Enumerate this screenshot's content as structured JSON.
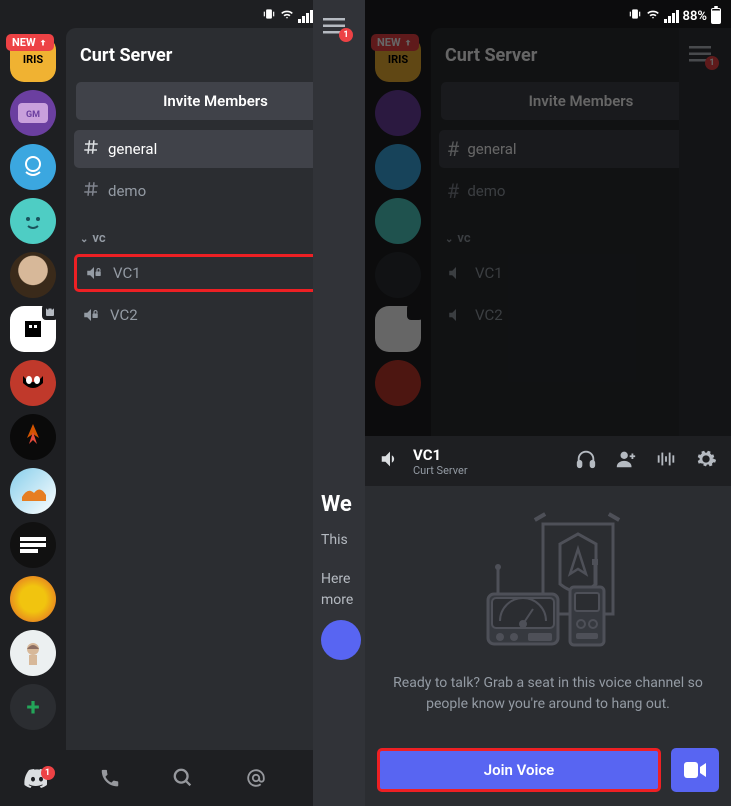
{
  "status": {
    "battery": "88%"
  },
  "server": {
    "title": "Curt Server",
    "new_badge": "NEW",
    "invite_label": "Invite Members",
    "text_channels": [
      {
        "name": "general",
        "active": true
      },
      {
        "name": "demo",
        "active": false
      }
    ],
    "voice_category": "vc",
    "voice_channels": [
      {
        "name": "VC1"
      },
      {
        "name": "VC2"
      }
    ]
  },
  "peek": {
    "welcome": "We",
    "subtitle_line1": "This",
    "subtitle_line2": "Here",
    "subtitle_line3": "more"
  },
  "bottom_nav": {
    "badge": "1"
  },
  "voice_panel": {
    "channel": "VC1",
    "server": "Curt Server",
    "prompt": "Ready to talk? Grab a seat in this voice channel so people know you're around to hang out.",
    "join_label": "Join Voice"
  },
  "server_icons": [
    {
      "bg": "#f0b232",
      "label": "IRIS",
      "shape": "square"
    },
    {
      "bg": "#6b3fa0",
      "label": "GM"
    },
    {
      "bg": "#3498db",
      "label": ""
    },
    {
      "bg": "#2ecc71",
      "label": ""
    },
    {
      "bg": "#2c2f33",
      "label": ""
    },
    {
      "bg": "#ffffff",
      "label": "",
      "shape": "square"
    },
    {
      "bg": "#e74c3c",
      "label": ""
    },
    {
      "bg": "#1e1f22",
      "label": ""
    },
    {
      "bg": "#e67e22",
      "label": ""
    },
    {
      "bg": "#111111",
      "label": ""
    },
    {
      "bg": "#f1c40f",
      "label": ""
    },
    {
      "bg": "#ecf0f1",
      "label": ""
    }
  ]
}
